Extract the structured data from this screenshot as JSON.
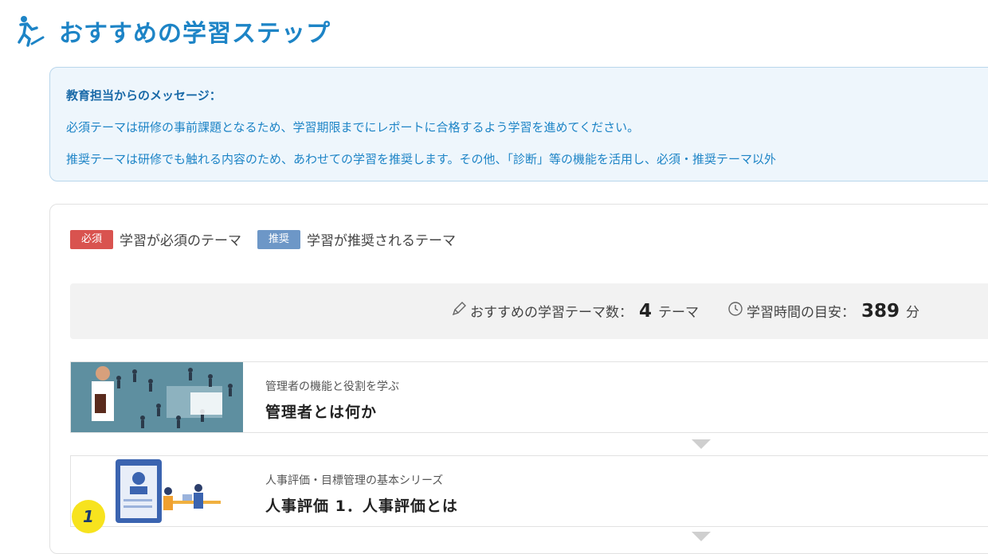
{
  "header": {
    "title": "おすすめの学習ステップ",
    "icon": "walking-person-icon"
  },
  "message": {
    "title": "教育担当からのメッセージ：",
    "line1": "必須テーマは研修の事前課題となるため、学習期限までにレポートに合格するよう学習を進めてください。",
    "line2": "推奨テーマは研修でも触れる内容のため、あわせての学習を推奨します。その他、「診断」等の機能を活用し、必須・推奨テーマ以外"
  },
  "legend": {
    "required_tag": "必須",
    "required_label": "学習が必須のテーマ",
    "recommended_tag": "推奨",
    "recommended_label": "学習が推奨されるテーマ"
  },
  "summary": {
    "theme_count_label": "おすすめの学習テーマ数：",
    "theme_count": "4",
    "theme_unit": "テーマ",
    "time_label": "学習時間の目安：",
    "time_value": "389",
    "time_unit": "分"
  },
  "themes": [
    {
      "subtitle": "管理者の機能と役割を学ぶ",
      "title": "管理者とは何か"
    },
    {
      "subtitle": "人事評価・目標管理の基本シリーズ",
      "title": "人事評価 1．人事評価とは",
      "step": "1"
    }
  ],
  "colors": {
    "accent": "#1d84c6",
    "required": "#d9534f",
    "recommended": "#6d97c7",
    "badge": "#f7e31e"
  }
}
